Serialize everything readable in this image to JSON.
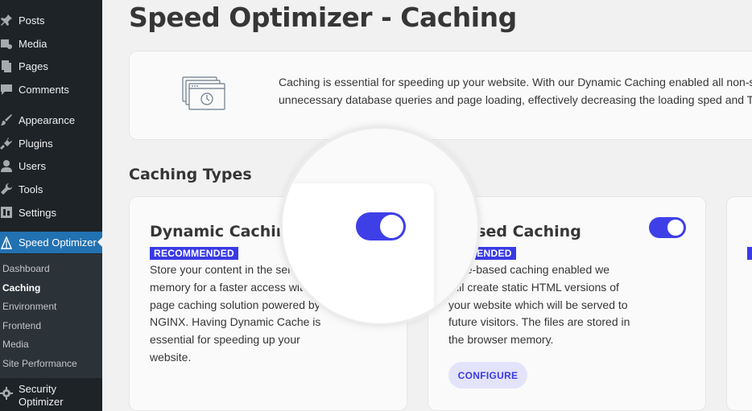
{
  "sidebar": {
    "items": [
      {
        "label": "Posts",
        "icon": "pin-icon"
      },
      {
        "label": "Media",
        "icon": "media-icon"
      },
      {
        "label": "Pages",
        "icon": "pages-icon"
      },
      {
        "label": "Comments",
        "icon": "comment-icon"
      },
      {
        "label": "Appearance",
        "icon": "brush-icon"
      },
      {
        "label": "Plugins",
        "icon": "plug-icon"
      },
      {
        "label": "Users",
        "icon": "user-icon"
      },
      {
        "label": "Tools",
        "icon": "wrench-icon"
      },
      {
        "label": "Settings",
        "icon": "settings-icon"
      },
      {
        "label": "Speed Optimizer",
        "icon": "speed-optimizer-icon"
      }
    ],
    "submenu": [
      "Dashboard",
      "Caching",
      "Environment",
      "Frontend",
      "Media",
      "Site Performance"
    ],
    "security": {
      "line1": "Security",
      "line2": "Optimizer"
    }
  },
  "main": {
    "title": "Speed Optimizer - Caching",
    "intro_line1": "Caching is essential for speeding up your website. With our Dynamic Caching enabled all non-static",
    "intro_line2": "unnecessary database queries and page loading, effectively decreasing the loading sped and TTFB",
    "section_title": "Caching Types"
  },
  "cards": [
    {
      "title": "Dynamic Caching",
      "badge": "RECOMMENDED",
      "desc": "Store your content in the server memory for a faster access with this page caching solution powered by NGINX. Having Dynamic Cache is essential for speeding up your website.",
      "desc_visible": [
        "Store your content in the server",
        "memory for a faster access with t",
        "page caching solution powered by",
        "NGINX. Having Dynamic Cache is",
        "essential for speeding up your",
        "website."
      ],
      "enabled": true
    },
    {
      "title": "-Based Caching",
      "badge": "OMMENDED",
      "desc_visible": [
        "n file-based caching enabled we",
        "will create static HTML versions of",
        "your website which will be served to",
        "future visitors. The files are stored in",
        "the browser memory."
      ],
      "button": "CONFIGURE",
      "enabled": true
    }
  ],
  "colors": {
    "accent": "#3f3fe8",
    "sidebar": "#1d2327",
    "active": "#2271b1"
  }
}
